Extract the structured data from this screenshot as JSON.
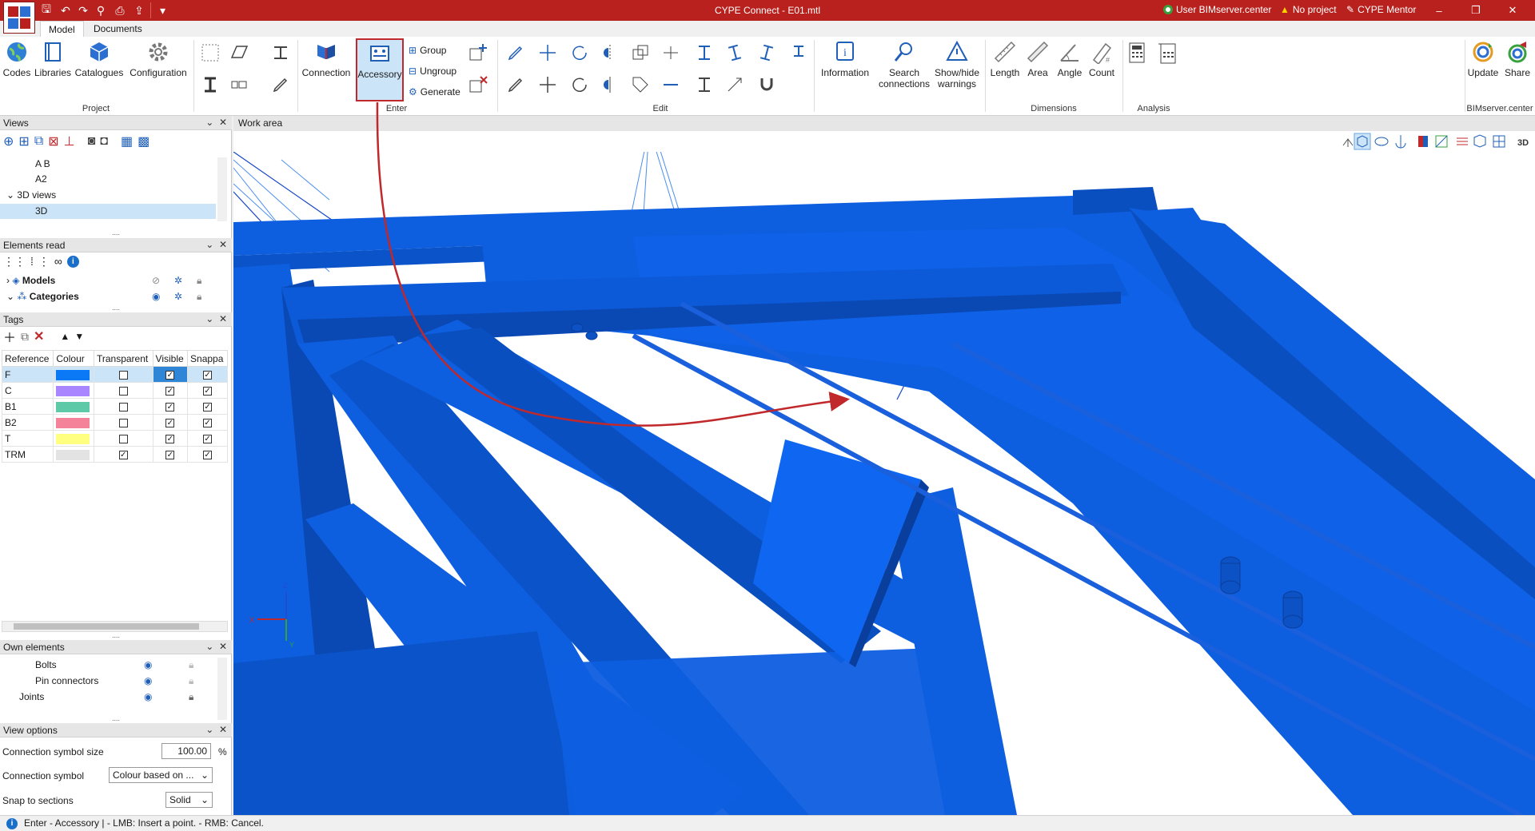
{
  "window": {
    "title": "CYPE Connect - E01.mtl",
    "user": "User BIMserver.center",
    "project": "No project",
    "mentor": "CYPE Mentor"
  },
  "tabs": [
    {
      "label": "Model"
    },
    {
      "label": "Documents"
    }
  ],
  "ribbon": {
    "project": {
      "label": "Project",
      "codes": "Codes",
      "libraries": "Libraries",
      "catalogues": "Catalogues",
      "configuration": "Configuration"
    },
    "enter": {
      "label": "Enter",
      "connection": "Connection",
      "accessory": "Accessory",
      "group": "Group",
      "ungroup": "Ungroup",
      "generate": "Generate"
    },
    "edit": {
      "label": "Edit"
    },
    "info": {
      "information": "Information",
      "search_line1": "Search",
      "search_line2": "connections",
      "showhide_line1": "Show/hide",
      "showhide_line2": "warnings"
    },
    "dimensions": {
      "label": "Dimensions",
      "length": "Length",
      "area": "Area",
      "angle": "Angle",
      "count": "Count"
    },
    "analysis": {
      "label": "Analysis"
    },
    "bimserver": {
      "label": "BIMserver.center",
      "update": "Update",
      "share": "Share"
    }
  },
  "panels": {
    "views": {
      "title": "Views",
      "items": [
        "A B",
        "A2",
        "3D views",
        "3D"
      ]
    },
    "elements_read": {
      "title": "Elements read",
      "models": "Models",
      "categories": "Categories"
    },
    "tags": {
      "title": "Tags",
      "headers": [
        "Reference",
        "Colour",
        "Transparent",
        "Visible",
        "Snappa"
      ],
      "rows": [
        {
          "ref": "F",
          "color": "#0b78f5",
          "transparent": false,
          "visible": true,
          "snap": true
        },
        {
          "ref": "C",
          "color": "#a986ff",
          "transparent": false,
          "visible": true,
          "snap": true
        },
        {
          "ref": "B1",
          "color": "#5ec9a7",
          "transparent": false,
          "visible": true,
          "snap": true
        },
        {
          "ref": "B2",
          "color": "#f4839a",
          "transparent": false,
          "visible": true,
          "snap": true
        },
        {
          "ref": "T",
          "color": "#ffff80",
          "transparent": false,
          "visible": true,
          "snap": true
        },
        {
          "ref": "TRM",
          "color": "#e3e3e3",
          "transparent": true,
          "visible": true,
          "snap": true
        }
      ]
    },
    "own_elements": {
      "title": "Own elements",
      "items": [
        "Bolts",
        "Pin connectors",
        "Joints"
      ]
    },
    "view_options": {
      "title": "View options",
      "symbol_size_label": "Connection symbol size",
      "symbol_size_value": "100.00",
      "symbol_size_unit": "%",
      "symbol_label": "Connection symbol",
      "symbol_value": "Colour based on ...",
      "snap_label": "Snap to sections",
      "snap_value": "Solid"
    }
  },
  "workarea": {
    "title": "Work area"
  },
  "status": {
    "text": "Enter - Accessory  |  - LMB: Insert a point. - RMB: Cancel."
  },
  "colors": {
    "accent": "#b8211d",
    "steel": "#0e5ee0",
    "steel_dark": "#0a48b4",
    "highlight": "#c0282b"
  }
}
